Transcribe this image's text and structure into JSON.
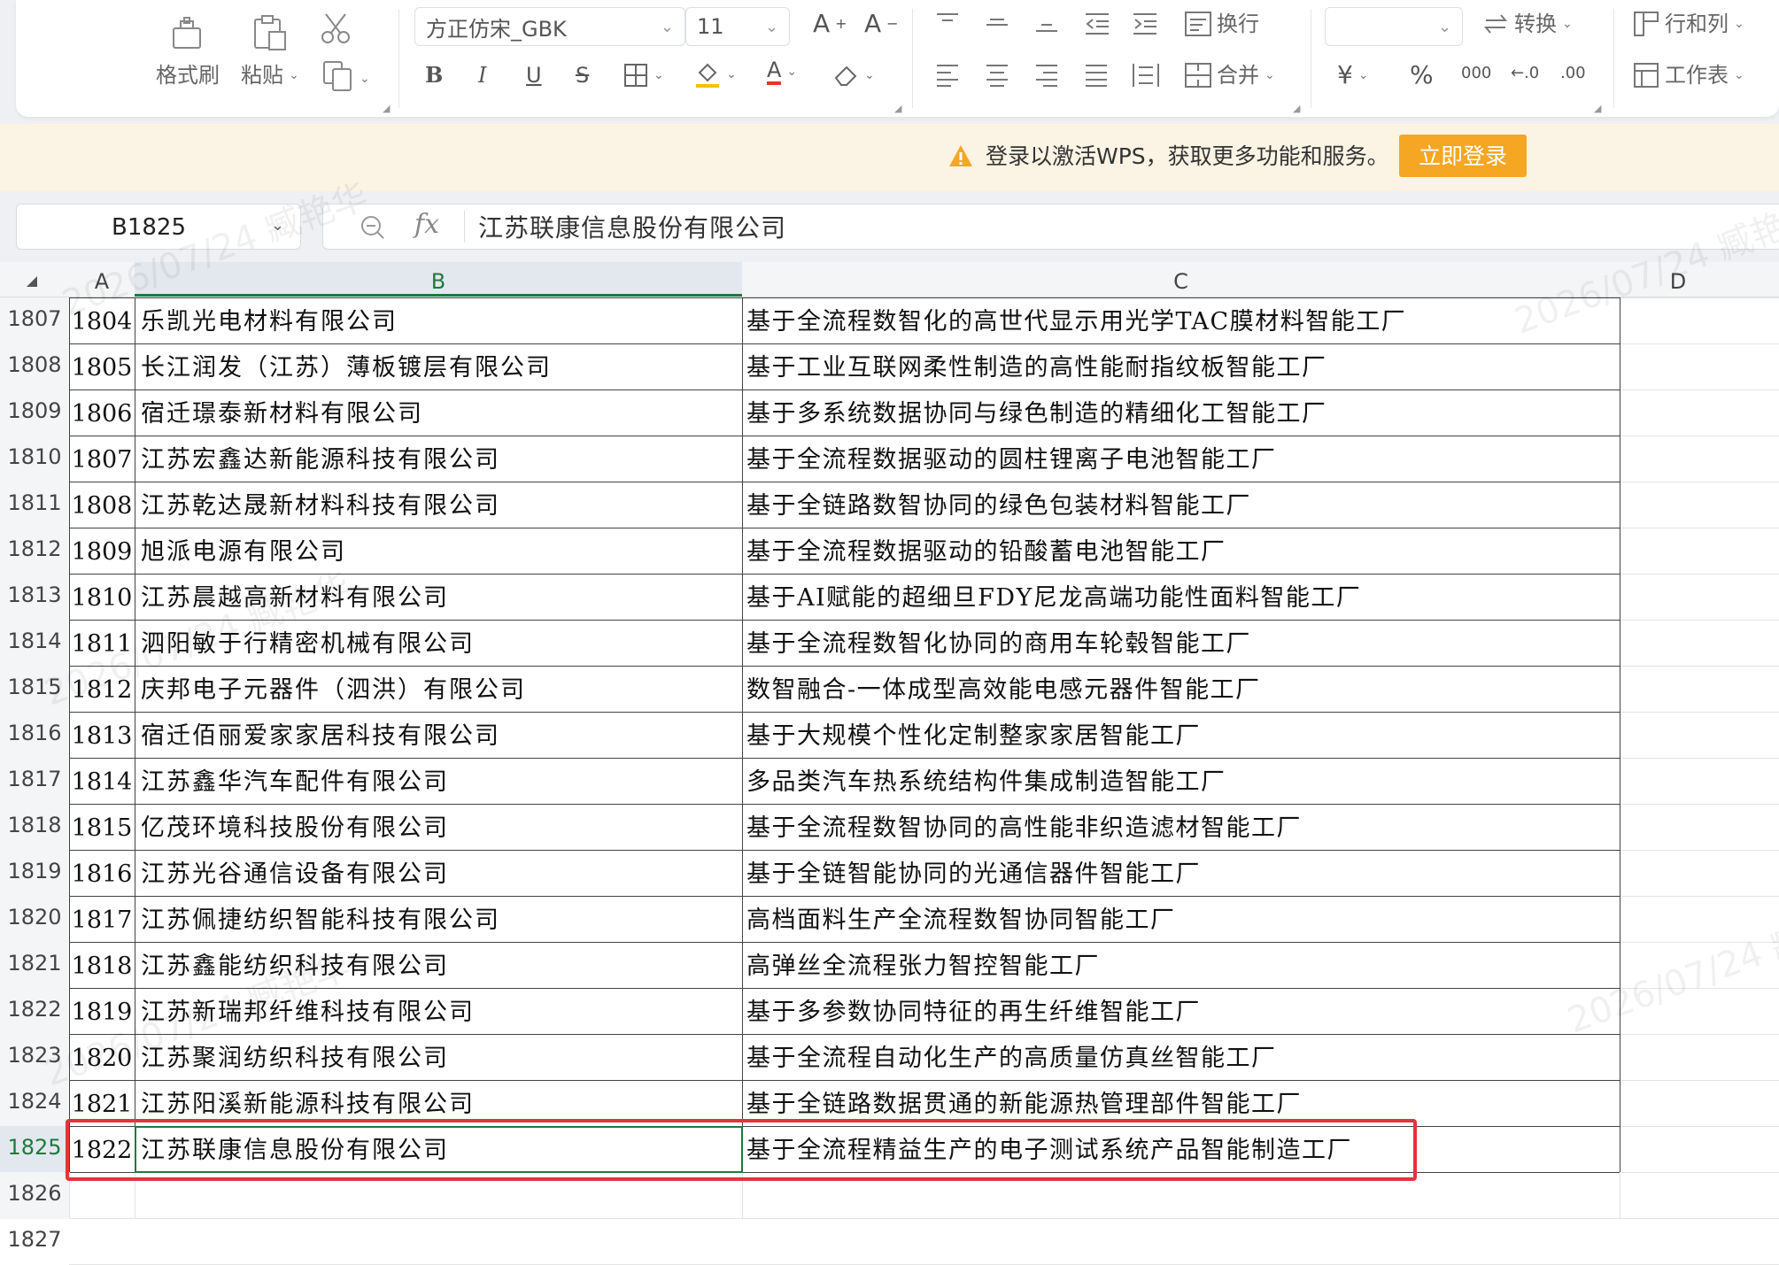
{
  "ribbon": {
    "format_painter": "格式刷",
    "paste": "粘贴",
    "font_name": "方正仿宋_GBK",
    "font_size": "11",
    "bold": "B",
    "italic": "I",
    "underline": "U",
    "strike": "S",
    "font_color_glyph": "A",
    "wrap": "换行",
    "merge": "合并",
    "convert": "转换",
    "row_col": "行和列",
    "worksheet": "工作表",
    "currency": "¥",
    "percent": "%",
    "thousands": "000",
    "dec_inc": "←.0",
    "dec_dec": ".00",
    "number_format_value": ""
  },
  "notice": {
    "text": "登录以激活WPS，获取更多功能和服务。",
    "button": "立即登录",
    "color": "#f5a623"
  },
  "formula_bar": {
    "cell_ref": "B1825",
    "fx": "fx",
    "value": "江苏联康信息股份有限公司"
  },
  "columns": [
    "A",
    "B",
    "C",
    "D"
  ],
  "selected_column": "B",
  "rows": [
    {
      "row": "1807",
      "a": "1804",
      "b": "乐凯光电材料有限公司",
      "c": "基于全流程数智化的高世代显示用光学TAC膜材料智能工厂"
    },
    {
      "row": "1808",
      "a": "1805",
      "b": "长江润发（江苏）薄板镀层有限公司",
      "c": "基于工业互联网柔性制造的高性能耐指纹板智能工厂"
    },
    {
      "row": "1809",
      "a": "1806",
      "b": "宿迁璟泰新材料有限公司",
      "c": "基于多系统数据协同与绿色制造的精细化工智能工厂"
    },
    {
      "row": "1810",
      "a": "1807",
      "b": "江苏宏鑫达新能源科技有限公司",
      "c": "基于全流程数据驱动的圆柱锂离子电池智能工厂"
    },
    {
      "row": "1811",
      "a": "1808",
      "b": "江苏乾达晟新材料科技有限公司",
      "c": "基于全链路数智协同的绿色包装材料智能工厂"
    },
    {
      "row": "1812",
      "a": "1809",
      "b": "旭派电源有限公司",
      "c": "基于全流程数据驱动的铅酸蓄电池智能工厂"
    },
    {
      "row": "1813",
      "a": "1810",
      "b": "江苏晨越高新材料有限公司",
      "c": "基于AI赋能的超细旦FDY尼龙高端功能性面料智能工厂"
    },
    {
      "row": "1814",
      "a": "1811",
      "b": "泗阳敏于行精密机械有限公司",
      "c": "基于全流程数智化协同的商用车轮毂智能工厂"
    },
    {
      "row": "1815",
      "a": "1812",
      "b": "庆邦电子元器件（泗洪）有限公司",
      "c": "数智融合-一体成型高效能电感元器件智能工厂"
    },
    {
      "row": "1816",
      "a": "1813",
      "b": "宿迁佰丽爱家家居科技有限公司",
      "c": "基于大规模个性化定制整家家居智能工厂"
    },
    {
      "row": "1817",
      "a": "1814",
      "b": "江苏鑫华汽车配件有限公司",
      "c": "多品类汽车热系统结构件集成制造智能工厂"
    },
    {
      "row": "1818",
      "a": "1815",
      "b": "亿茂环境科技股份有限公司",
      "c": "基于全流程数智协同的高性能非织造滤材智能工厂"
    },
    {
      "row": "1819",
      "a": "1816",
      "b": "江苏光谷通信设备有限公司",
      "c": "基于全链智能协同的光通信器件智能工厂"
    },
    {
      "row": "1820",
      "a": "1817",
      "b": "江苏佩捷纺织智能科技有限公司",
      "c": "高档面料生产全流程数智协同智能工厂"
    },
    {
      "row": "1821",
      "a": "1818",
      "b": "江苏鑫能纺织科技有限公司",
      "c": "高弹丝全流程张力智控智能工厂"
    },
    {
      "row": "1822",
      "a": "1819",
      "b": "江苏新瑞邦纤维科技有限公司",
      "c": "基于多参数协同特征的再生纤维智能工厂"
    },
    {
      "row": "1823",
      "a": "1820",
      "b": "江苏聚润纺织科技有限公司",
      "c": "基于全流程自动化生产的高质量仿真丝智能工厂"
    },
    {
      "row": "1824",
      "a": "1821",
      "b": "江苏阳溪新能源科技有限公司",
      "c": "基于全链路数据贯通的新能源热管理部件智能工厂"
    },
    {
      "row": "1825",
      "a": "1822",
      "b": "江苏联康信息股份有限公司",
      "c": "基于全流程精益生产的电子测试系统产品智能制造工厂"
    },
    {
      "row": "1826",
      "a": "",
      "b": "",
      "c": ""
    },
    {
      "row": "1827",
      "a": "",
      "b": "",
      "c": ""
    }
  ],
  "selected_row": "1825",
  "watermark": "2026/07/24 臧艳华",
  "highlight_color": "#e3343d",
  "selection_color": "#1d7a3c"
}
